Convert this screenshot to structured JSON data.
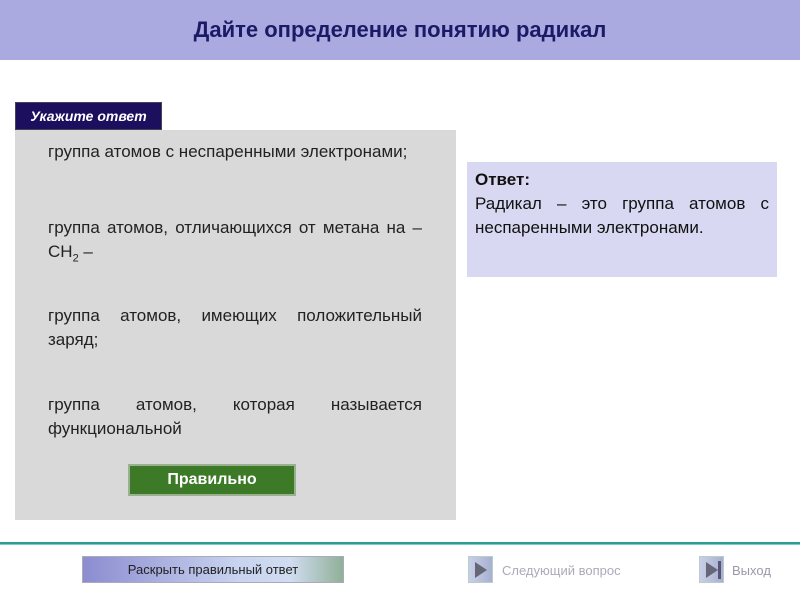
{
  "header": {
    "title": "Дайте определение понятию радикал"
  },
  "question": {
    "prompt_label": "Укажите ответ",
    "options": [
      "группа атомов с неспаренными электронами;",
      "группа атомов, отличающихся от метана на – CH",
      "группа атомов, имеющих положительный заряд;",
      "группа атомов, которая называется функциональной"
    ],
    "option2_sub": "2",
    "option2_tail": " –",
    "check_button": "Правильно"
  },
  "answer": {
    "heading": "Ответ:",
    "text": "Радикал – это группа атомов с неспаренными электронами."
  },
  "footer": {
    "reveal": "Раскрыть правильный ответ",
    "next": "Следующий вопрос",
    "exit": "Выход"
  }
}
